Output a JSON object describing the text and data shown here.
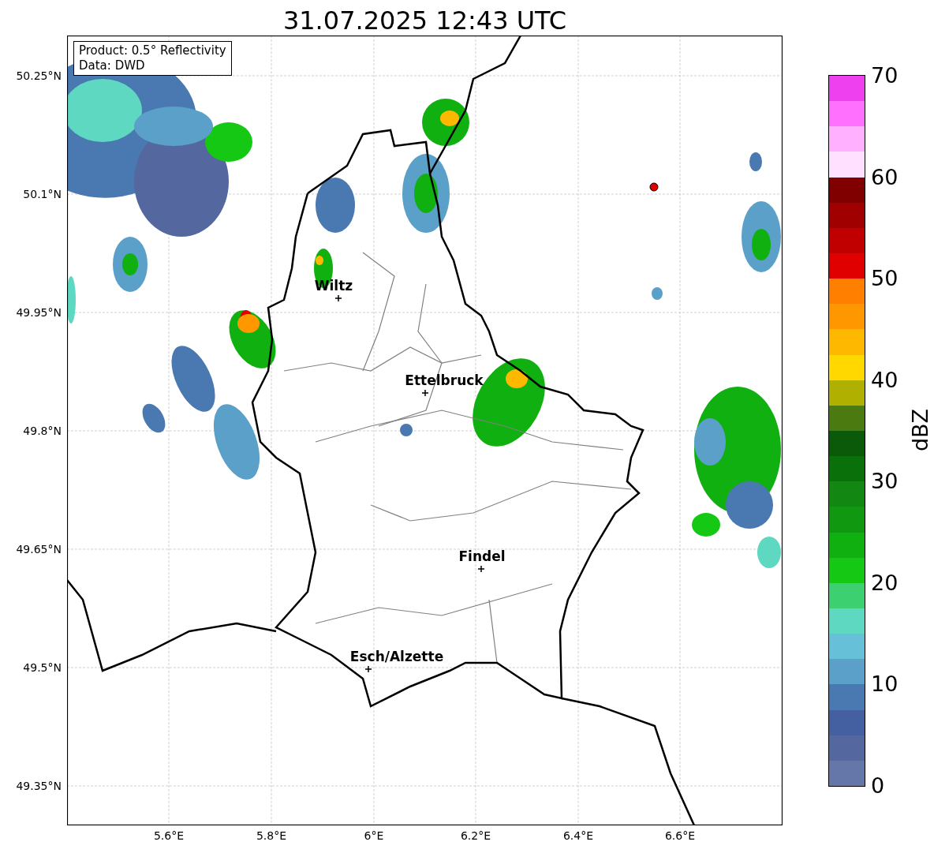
{
  "title": "31.07.2025 12:43 UTC",
  "info": [
    "Product: 0.5° Reflectivity",
    "Data: DWD"
  ],
  "y_ticks": [
    "50.25°N",
    "50.1°N",
    "49.95°N",
    "49.8°N",
    "49.65°N",
    "49.5°N",
    "49.35°N"
  ],
  "x_ticks": [
    "5.6°E",
    "5.8°E",
    "6°E",
    "6.2°E",
    "6.4°E",
    "6.6°E"
  ],
  "cities": [
    "Wiltz",
    "Ettelbruck",
    "Findel",
    "Esch/Alzette"
  ],
  "colorbar": {
    "label": "dBZ",
    "ticks": [
      "70",
      "60",
      "50",
      "40",
      "30",
      "20",
      "10",
      "0"
    ],
    "segments": [
      {
        "color": "#ee40ee"
      },
      {
        "color": "#ff70ff"
      },
      {
        "color": "#ffb0ff"
      },
      {
        "color": "#ffe0ff"
      },
      {
        "color": "#800000"
      },
      {
        "color": "#a00000"
      },
      {
        "color": "#c00000"
      },
      {
        "color": "#e00000"
      },
      {
        "color": "#ff7f00"
      },
      {
        "color": "#ff9800"
      },
      {
        "color": "#ffb800"
      },
      {
        "color": "#ffd800"
      },
      {
        "color": "#b0b000"
      },
      {
        "color": "#4a7a10"
      },
      {
        "color": "#0a5a0a"
      },
      {
        "color": "#0a700a"
      },
      {
        "color": "#128812"
      },
      {
        "color": "#109810"
      },
      {
        "color": "#10b010"
      },
      {
        "color": "#14c814"
      },
      {
        "color": "#3cd070"
      },
      {
        "color": "#5ed8c0"
      },
      {
        "color": "#65c0d8"
      },
      {
        "color": "#5aa0c8"
      },
      {
        "color": "#4a78b0"
      },
      {
        "color": "#4560a0"
      },
      {
        "color": "#54679f"
      },
      {
        "color": "#6577a8"
      }
    ]
  }
}
